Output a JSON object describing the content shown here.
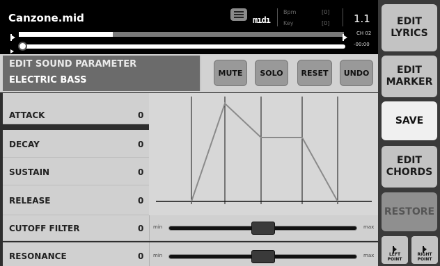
{
  "topbar": {
    "song_title": "Canzone.mid",
    "list_icon": "list-icon",
    "midi_logo": "mıdı",
    "bpm_label": "Bpm",
    "bpm_value": "[0]",
    "key_label": "Key",
    "key_value": "[0]",
    "bar_position": "1.1",
    "channel": "CH 02",
    "time_remaining": "-00:00",
    "loop_progress": 0.29,
    "song_progress": 0.0
  },
  "header": {
    "title": "EDIT SOUND PARAMETER",
    "instrument": "ELECTRIC BASS",
    "buttons": [
      "MUTE",
      "SOLO",
      "RESET",
      "UNDO"
    ]
  },
  "params": [
    {
      "label": "ATTACK",
      "value": "0"
    },
    {
      "label": "DECAY",
      "value": "0"
    },
    {
      "label": "SUSTAIN",
      "value": "0"
    },
    {
      "label": "RELEASE",
      "value": "0"
    }
  ],
  "sliders": [
    {
      "label": "CUTOFF FILTER",
      "value": "0",
      "min_label": "min",
      "max_label": "max",
      "level": 0.5
    },
    {
      "label": "RESONANCE",
      "value": "0",
      "min_label": "min",
      "max_label": "max",
      "level": 0.5
    }
  ],
  "side": {
    "edit_lyrics": [
      "EDIT",
      "LYRICS"
    ],
    "edit_marker": [
      "EDIT",
      "MARKER"
    ],
    "save": "SAVE",
    "edit_chords": [
      "EDIT",
      "CHORDS"
    ],
    "restore": "RESTORE",
    "left_point": [
      "LEFT",
      "POINT"
    ],
    "right_point": [
      "RIGHT",
      "POINT"
    ]
  },
  "colors": {
    "accent_dark": "#000000",
    "panel": "#d0d0d0",
    "header_title_bg": "#6b6b6b",
    "side_button": "#c3c3c3",
    "envelope_line": "#8a8a8a"
  }
}
